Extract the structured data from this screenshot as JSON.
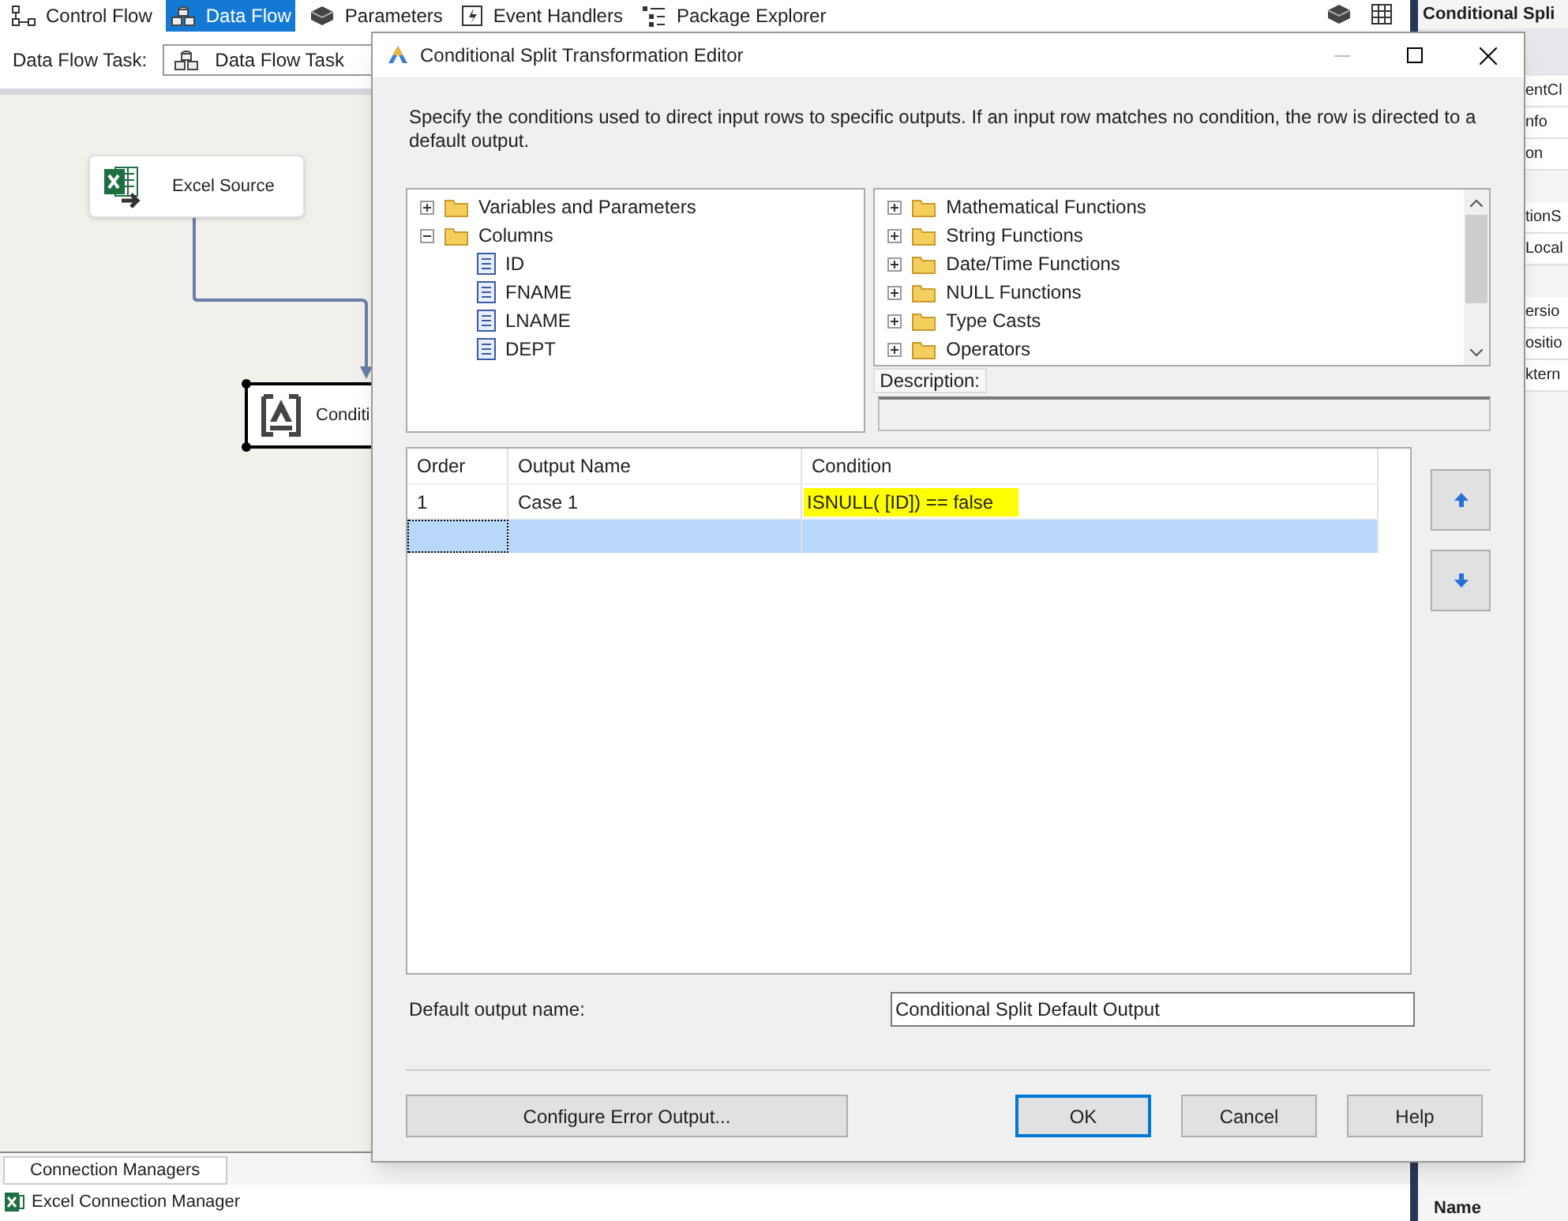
{
  "toolbar": {
    "tabs": [
      {
        "label": "Control Flow",
        "kind": "control",
        "selected": false
      },
      {
        "label": "Data Flow",
        "kind": "data",
        "selected": true
      },
      {
        "label": "Parameters",
        "kind": "params",
        "selected": false
      },
      {
        "label": "Event Handlers",
        "kind": "events",
        "selected": false
      },
      {
        "label": "Package Explorer",
        "kind": "explorer",
        "selected": false
      }
    ]
  },
  "task_bar": {
    "label": "Data Flow Task:",
    "value": "Data Flow Task"
  },
  "canvas": {
    "nodes": [
      {
        "label": "Excel Source",
        "kind": "source",
        "selected": false
      },
      {
        "label": "Conditi",
        "kind": "split",
        "selected": true
      }
    ]
  },
  "connection_managers": {
    "tab": "Connection Managers",
    "items": [
      "Excel Connection Manager"
    ]
  },
  "properties_panel": {
    "title": "Conditional Spli",
    "groups": [
      [
        "entCl",
        "nfo",
        "on"
      ],
      [
        "tionS",
        "Local"
      ],
      [
        "ersio",
        "ositio",
        "ktern"
      ]
    ],
    "footer": "Name"
  },
  "dialog": {
    "title": "Conditional Split Transformation Editor",
    "instructions": "Specify the conditions used to direct input rows to specific outputs. If an input row matches no condition, the row is directed to a default output.",
    "input_tree": [
      {
        "label": "Variables and Parameters",
        "kind": "folder",
        "expanded": false
      },
      {
        "label": "Columns",
        "kind": "folder",
        "expanded": true,
        "children": [
          {
            "label": "ID",
            "kind": "column"
          },
          {
            "label": "FNAME",
            "kind": "column"
          },
          {
            "label": "LNAME",
            "kind": "column"
          },
          {
            "label": "DEPT",
            "kind": "column"
          }
        ]
      }
    ],
    "function_tree": [
      {
        "label": "Mathematical Functions",
        "expanded": false
      },
      {
        "label": "String Functions",
        "expanded": false
      },
      {
        "label": "Date/Time Functions",
        "expanded": false
      },
      {
        "label": "NULL Functions",
        "expanded": false
      },
      {
        "label": "Type Casts",
        "expanded": false
      },
      {
        "label": "Operators",
        "expanded": false
      }
    ],
    "description_label": "Description:",
    "grid": {
      "columns": [
        "Order",
        "Output Name",
        "Condition"
      ],
      "rows": [
        {
          "order": "1",
          "output_name": "Case 1",
          "condition": "ISNULL( [ID]) == false",
          "condition_highlighted": true,
          "selected": false
        },
        {
          "selected": true
        }
      ]
    },
    "default_output": {
      "label": "Default output name:",
      "value": "Conditional Split Default Output"
    },
    "buttons": [
      {
        "label": "Configure Error Output...",
        "kind": "left",
        "default": false
      },
      {
        "label": "OK",
        "kind": "right",
        "default": true
      },
      {
        "label": "Cancel",
        "kind": "right",
        "default": false
      },
      {
        "label": "Help",
        "kind": "right",
        "default": false
      }
    ]
  }
}
